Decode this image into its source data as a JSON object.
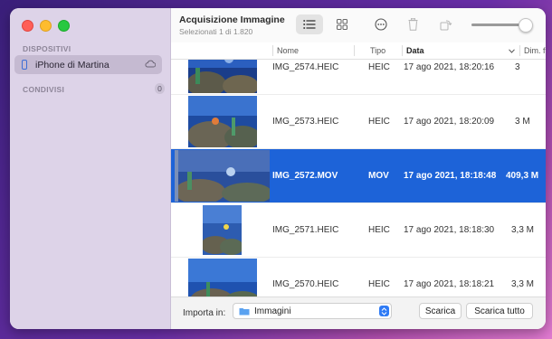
{
  "sidebar": {
    "section_devices": "DISPOSITIVI",
    "device_name": "iPhone di Martina",
    "section_shared": "CONDIVISI",
    "shared_count": "0"
  },
  "toolbar": {
    "title": "Acquisizione Immagine",
    "subtitle": "Selezionati 1 di 1.820",
    "icons": [
      "list-view-icon",
      "grid-view-icon",
      "more-icon",
      "trash-icon",
      "rotate-icon"
    ],
    "zoom_level": 0.9
  },
  "columns": {
    "name": "Nome",
    "type": "Tipo",
    "date": "Data",
    "size": "Dim. f"
  },
  "rows": [
    {
      "name": "IMG_2574.HEIC",
      "type": "HEIC",
      "date": "17 ago 2021, 18:20:16",
      "size": "3",
      "selected": false
    },
    {
      "name": "IMG_2573.HEIC",
      "type": "HEIC",
      "date": "17 ago 2021, 18:20:09",
      "size": "3 M",
      "selected": false
    },
    {
      "name": "IMG_2572.MOV",
      "type": "MOV",
      "date": "17 ago 2021, 18:18:48",
      "size": "409,3 M",
      "selected": true
    },
    {
      "name": "IMG_2571.HEIC",
      "type": "HEIC",
      "date": "17 ago 2021, 18:18:30",
      "size": "3,3 M",
      "selected": false
    },
    {
      "name": "IMG_2570.HEIC",
      "type": "HEIC",
      "date": "17 ago 2021, 18:18:21",
      "size": "3,3 M",
      "selected": false
    }
  ],
  "footer": {
    "import_label": "Importa in:",
    "destination": "Immagini",
    "download_button": "Scarica",
    "download_all_button": "Scarica tutto"
  },
  "colors": {
    "selection": "#1d63d8",
    "sidebar_bg": "#ddd3e8",
    "accent": "#2f7bf5"
  }
}
